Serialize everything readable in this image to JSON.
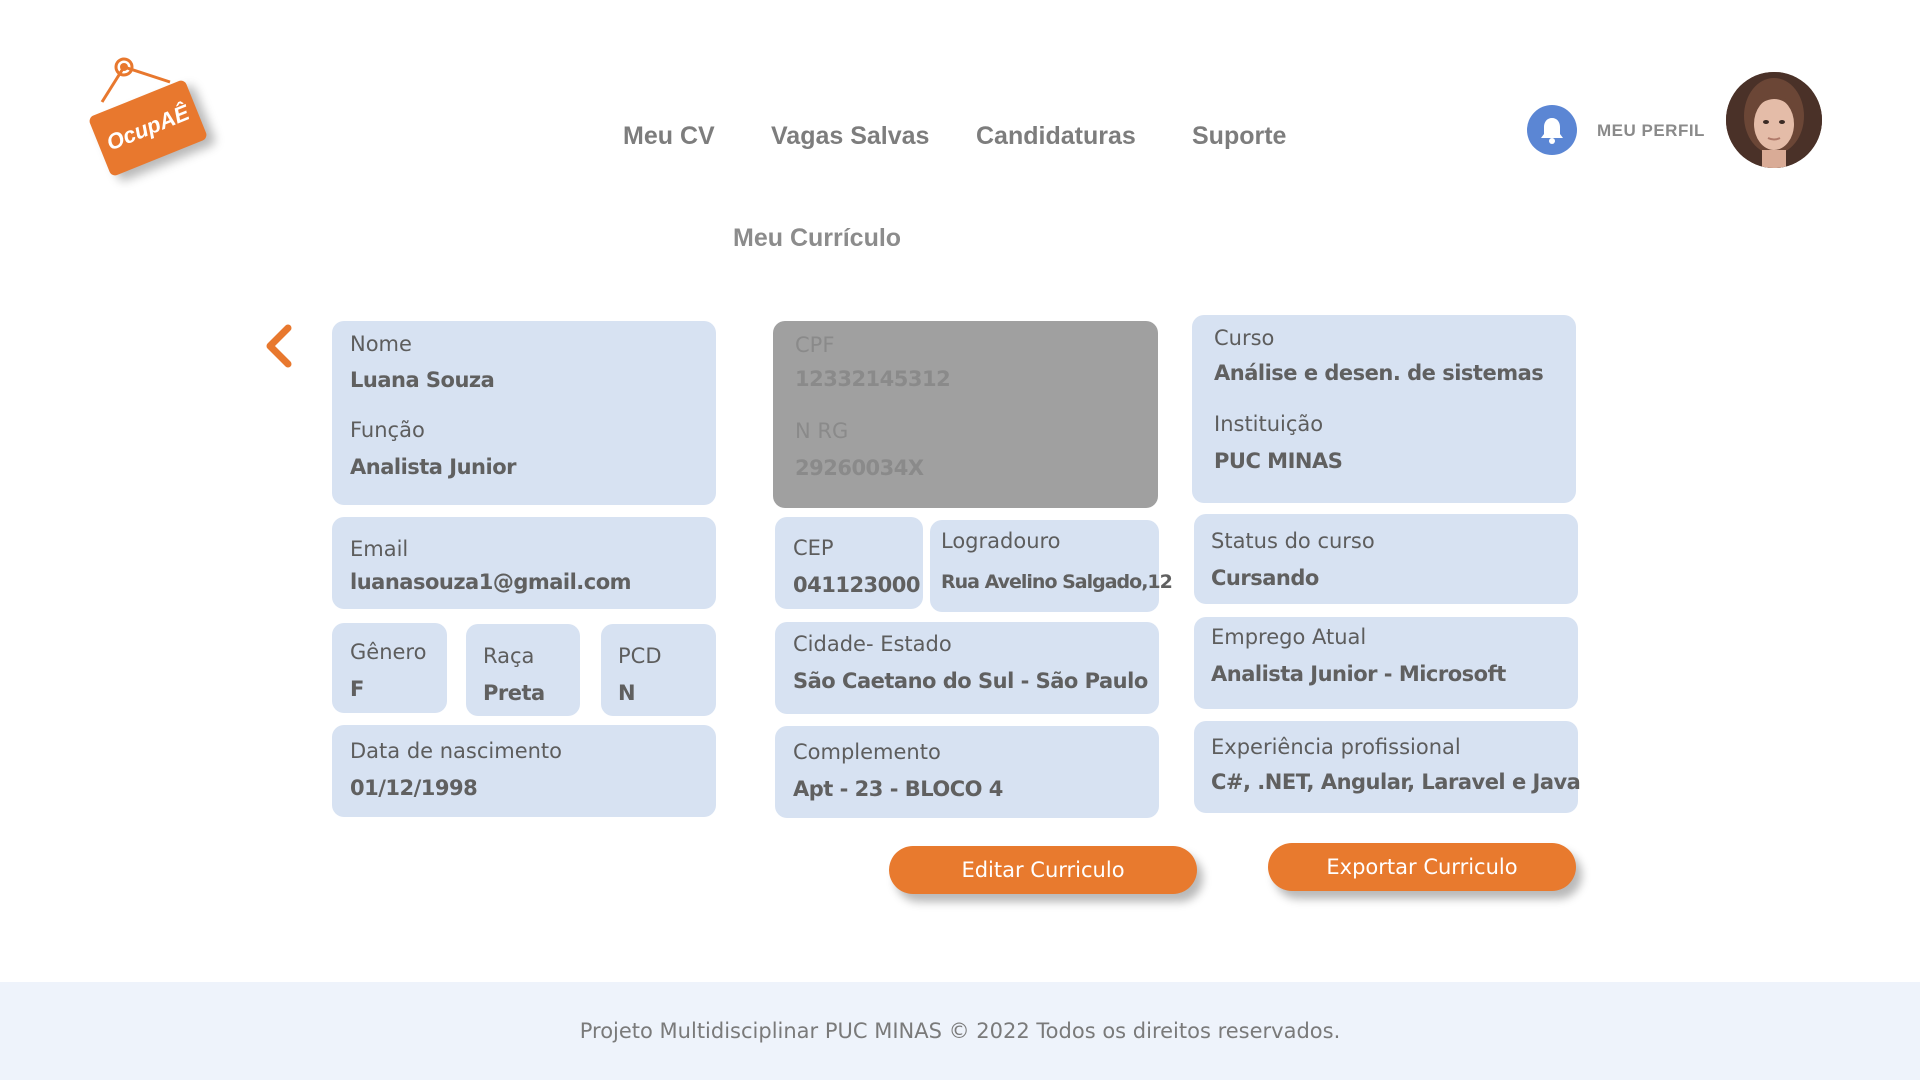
{
  "logo": {
    "text": "OcupAÊ"
  },
  "nav": {
    "items": [
      {
        "label": "Meu CV"
      },
      {
        "label": "Vagas Salvas"
      },
      {
        "label": "Candidaturas"
      },
      {
        "label": "Suporte"
      }
    ],
    "profile_label": "MEU PERFIL"
  },
  "page": {
    "title": "Meu Currículo"
  },
  "personal": {
    "nome_label": "Nome",
    "nome": "Luana Souza",
    "funcao_label": "Função",
    "funcao": "Analista Junior",
    "email_label": "Email",
    "email": "luanasouza1@gmail.com",
    "genero_label": "Gênero",
    "genero": "F",
    "raca_label": "Raça",
    "raca": "Preta",
    "pcd_label": "PCD",
    "pcd": "N",
    "nascimento_label": "Data de nascimento",
    "nascimento": "01/12/1998"
  },
  "documents": {
    "cpf_label": "CPF",
    "cpf": "12332145312",
    "rg_label": "N RG",
    "rg": "29260034X"
  },
  "address": {
    "cep_label": "CEP",
    "cep": "041123000",
    "logradouro_label": "Logradouro",
    "logradouro": "Rua Avelino Salgado,12",
    "cidade_label": "Cidade- Estado",
    "cidade": "São Caetano do Sul - São Paulo",
    "complemento_label": "Complemento",
    "complemento": "Apt - 23 - BLOCO 4"
  },
  "education": {
    "curso_label": "Curso",
    "curso": "Análise e desen. de sistemas",
    "instituicao_label": "Instituição",
    "instituicao": "PUC MINAS",
    "status_label": "Status do curso",
    "status": "Cursando"
  },
  "work": {
    "emprego_label": "Emprego Atual",
    "emprego": "Analista Junior - Microsoft",
    "experiencia_label": "Experiência profissional",
    "experiencia": "C#, .NET, Angular, Laravel e Java"
  },
  "actions": {
    "edit_label": "Editar Curriculo",
    "export_label": "Exportar Curriculo"
  },
  "footer": {
    "text": "Projeto Multidisciplinar  PUC MINAS © 2022 Todos os direitos reservados."
  },
  "colors": {
    "accent": "#e87a2e",
    "card": "#d7e2f2",
    "card_disabled": "#a0a0a0",
    "bell": "#5b86d4",
    "footer_bg": "#eef3fb"
  },
  "icons": [
    "hanging-sign-logo",
    "bell-icon",
    "avatar-photo",
    "chevron-left-icon"
  ]
}
